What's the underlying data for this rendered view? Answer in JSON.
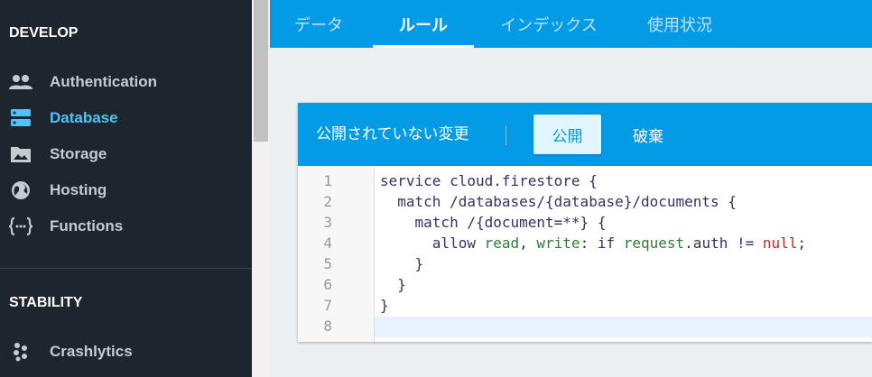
{
  "sidebar": {
    "develop_title": "DEVELOP",
    "stability_title": "STABILITY",
    "items": [
      {
        "label": "Authentication",
        "icon": "people-icon"
      },
      {
        "label": "Database",
        "icon": "database-icon",
        "active": true
      },
      {
        "label": "Storage",
        "icon": "image-folder-icon"
      },
      {
        "label": "Hosting",
        "icon": "globe-icon"
      },
      {
        "label": "Functions",
        "icon": "functions-icon"
      }
    ],
    "stability_items": [
      {
        "label": "Crashlytics",
        "icon": "crashlytics-icon"
      }
    ]
  },
  "tabs": [
    {
      "label": "データ"
    },
    {
      "label": "ルール",
      "active": true
    },
    {
      "label": "インデックス"
    },
    {
      "label": "使用状況"
    }
  ],
  "editor": {
    "status_text": "公開されていない変更",
    "publish_label": "公開",
    "discard_label": "破棄",
    "line_numbers": [
      "1",
      "2",
      "3",
      "4",
      "5",
      "6",
      "7",
      "8"
    ],
    "code": [
      "service cloud.firestore {",
      "  match /databases/{database}/documents {",
      "    match /{document=**} {",
      "      allow read, write: if request.auth != null;",
      "    }",
      "  }",
      "}",
      ""
    ]
  },
  "colors": {
    "sidebar_bg": "#1d252e",
    "accent": "#039be5",
    "active_nav": "#4fc3f7"
  }
}
